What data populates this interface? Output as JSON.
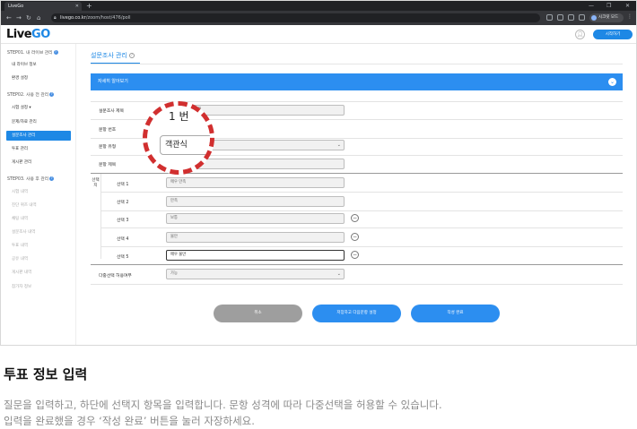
{
  "browser": {
    "tab_title": "LiveGo",
    "url_host": "livego.co.kr",
    "url_path": "/zoom/host/476/poll",
    "profile_label": "시크릿 모드"
  },
  "header": {
    "logo_main": "Live",
    "logo_accent": "GO",
    "start_button": "시작하기"
  },
  "sidebar": {
    "step1": "STEP01. 내 라이브 관리",
    "step1_items": [
      "내 라이브 정보",
      "환경 설정"
    ],
    "step2": "STEP02. 사용 전 관리",
    "step2_items": [
      "시험 설정 ▾",
      "문제/자료 관리",
      "설문조사 관리",
      "투표 관리",
      "게시판 관리"
    ],
    "step3": "STEP03. 사용 후 관리",
    "step3_items": [
      "시험 내역",
      "진단 퀴즈 내역",
      "채팅 내역",
      "설문조사 내역",
      "투표 내역",
      "공유 내역",
      "게시판 내역",
      "참가자 정보"
    ]
  },
  "main": {
    "page_title": "설문조사 관리",
    "detail_bar": "자세히 알아보기",
    "survey_title_label": "설문조사 제목",
    "survey_title_value": "온라인 학습에 관해",
    "question_no_label": "문항 번호",
    "question_type_label": "문항 유형",
    "question_type_value": "객관식",
    "question_title_label": "문항 제목",
    "question_title_value": "만족도는?",
    "choices_label": "선택지",
    "choices": [
      {
        "label": "선택 1",
        "value": "매우 만족"
      },
      {
        "label": "선택 2",
        "value": "만족"
      },
      {
        "label": "선택 3",
        "value": "보통"
      },
      {
        "label": "선택 4",
        "value": "불만"
      },
      {
        "label": "선택 5",
        "value": "매우 불만"
      }
    ],
    "multi_label": "다중선택 허용여부",
    "multi_value": "가능",
    "buttons": {
      "cancel": "취소",
      "save_next": "저장하고 다음문항 설정",
      "complete": "작성 완료"
    }
  },
  "magnifier": {
    "big_text": "1 번",
    "input_text": "객관식"
  },
  "caption": {
    "title": "투표 정보 입력",
    "line1": "질문을 입력하고, 하단에 선택지 항목을 입력합니다. 문항 성격에 따라 다중선택을 허용할 수 있습니다.",
    "line2": "입력을 완료했을 경우 ‘작성 완료’ 버튼을 눌러 자장하세요."
  },
  "colors": {
    "accent": "#1e88e5",
    "bar": "#2c8ef0",
    "cancel": "#9e9e9e",
    "highlight": "#d12f2f"
  }
}
